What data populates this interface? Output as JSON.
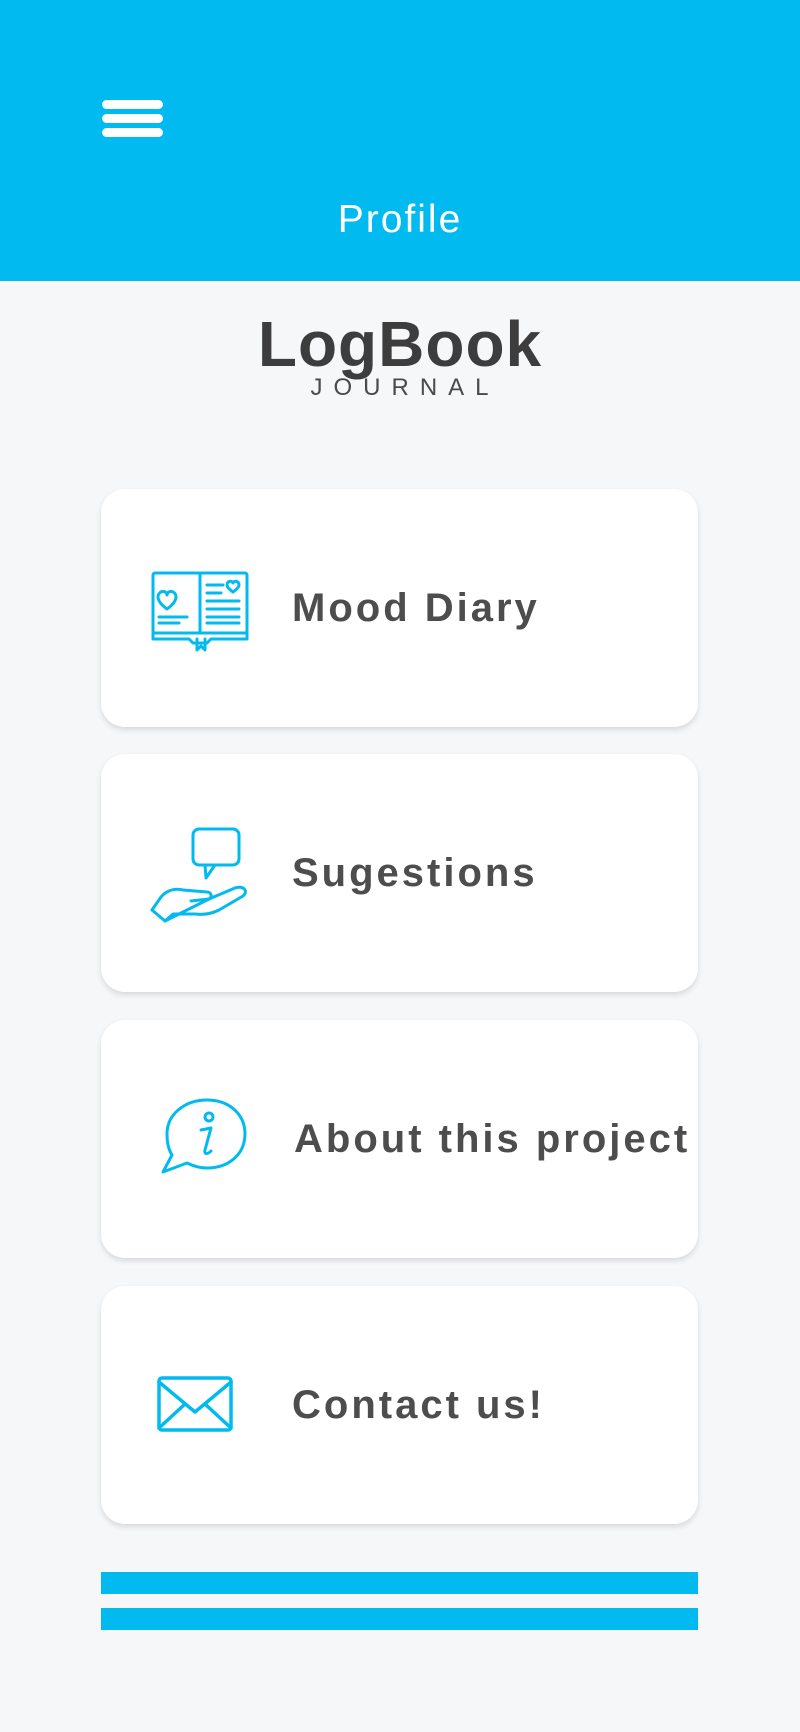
{
  "header": {
    "title": "Profile",
    "menu_icon": "hamburger-menu-icon",
    "color": "#00baf0"
  },
  "brand": {
    "name": "LogBook",
    "subtitle": "JOURNAL"
  },
  "menu": [
    {
      "label": "Mood Diary",
      "icon": "diary-book-icon"
    },
    {
      "label": "Sugestions",
      "icon": "hand-speech-bubble-icon"
    },
    {
      "label": "About this project",
      "icon": "info-bubble-icon"
    },
    {
      "label": "Contact us!",
      "icon": "envelope-icon"
    }
  ],
  "colors": {
    "accent": "#00baf0",
    "background": "#f5f7f9",
    "card": "#ffffff",
    "text": "#4d4d4d"
  }
}
